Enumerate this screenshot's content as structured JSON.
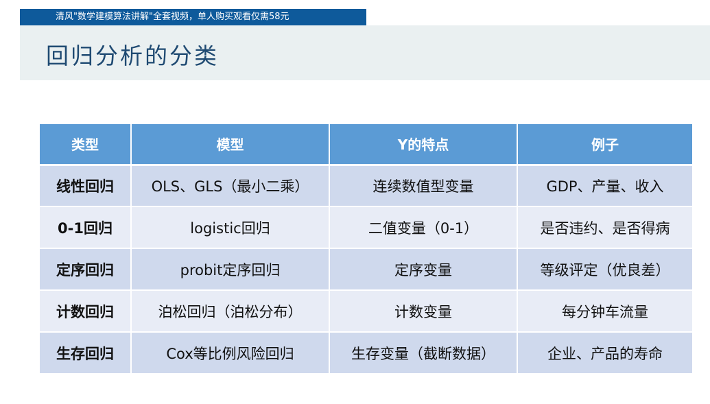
{
  "banner": {
    "text": "清风\"数学建模算法讲解\"全套视频，单人购买观看仅需58元"
  },
  "title": "回归分析的分类",
  "table": {
    "headers": [
      "类型",
      "模型",
      "Y的特点",
      "例子"
    ],
    "rows": [
      [
        "线性回归",
        "OLS、GLS（最小二乘）",
        "连续数值型变量",
        "GDP、产量、收入"
      ],
      [
        "0-1回归",
        "logistic回归",
        "二值变量（0-1）",
        "是否违约、是否得病"
      ],
      [
        "定序回归",
        "probit定序回归",
        "定序变量",
        "等级评定（优良差）"
      ],
      [
        "计数回归",
        "泊松回归（泊松分布）",
        "计数变量",
        "每分钟车流量"
      ],
      [
        "生存回归",
        "Cox等比例风险回归",
        "生存变量（截断数据）",
        "企业、产品的寿命"
      ]
    ]
  },
  "colors": {
    "banner_bg": "#0e5a9b",
    "title_bg": "#eaf0f1",
    "title_text": "#1f4a72",
    "header_bg": "#5b9bd5",
    "row_dark": "#cfd9ed",
    "row_light": "#e8ecf6"
  }
}
